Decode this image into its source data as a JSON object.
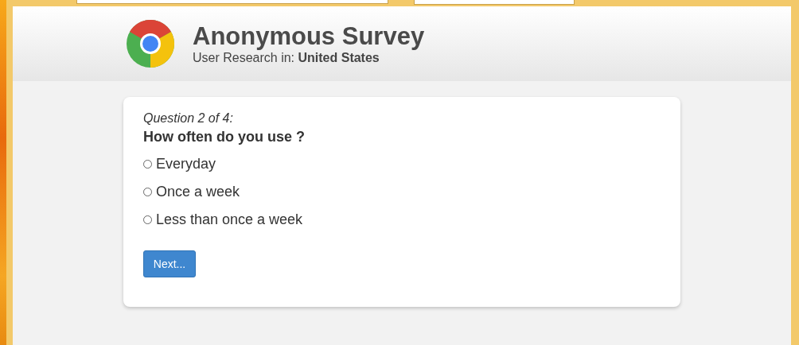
{
  "header": {
    "title": "Anonymous Survey",
    "subtitle": "User Research in: **United States**"
  },
  "question": {
    "counter": "Question 2 of 4:",
    "text": "How often do you use ?",
    "options": [
      {
        "label": "Everyday",
        "selected": false
      },
      {
        "label": "Once a week",
        "selected": false
      },
      {
        "label": "Less than once a week",
        "selected": false
      }
    ]
  },
  "buttons": [
    "Next..."
  ]
}
